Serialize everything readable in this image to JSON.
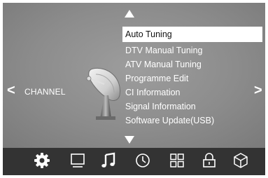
{
  "menu": {
    "items": [
      {
        "label": "Auto Tuning",
        "selected": true
      },
      {
        "label": "DTV Manual Tuning",
        "selected": false
      },
      {
        "label": "ATV Manual Tuning",
        "selected": false
      },
      {
        "label": "Programme Edit",
        "selected": false
      },
      {
        "label": "CI Information",
        "selected": false
      },
      {
        "label": "Signal Information",
        "selected": false
      },
      {
        "label": "Software Update(USB)",
        "selected": false
      }
    ]
  },
  "section": {
    "label": "CHANNEL",
    "prev_glyph": "<",
    "next_glyph": ">"
  },
  "tabs": [
    {
      "icon": "gear-icon",
      "active": true
    },
    {
      "icon": "monitor-icon",
      "active": false
    },
    {
      "icon": "music-note-icon",
      "active": false
    },
    {
      "icon": "clock-icon",
      "active": false
    },
    {
      "icon": "grid-icon",
      "active": false
    },
    {
      "icon": "lock-icon",
      "active": false
    },
    {
      "icon": "cube-icon",
      "active": false
    }
  ],
  "colors": {
    "panel": "#8c8c8c",
    "bar": "#333333",
    "highlight": "#ffffff",
    "text": "#ffffff"
  }
}
